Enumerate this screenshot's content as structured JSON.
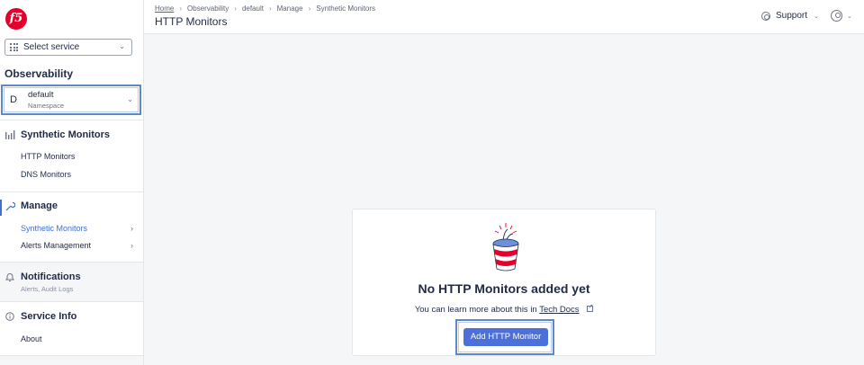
{
  "brand": {
    "logo_text": "f5",
    "logo_color": "#e4002b"
  },
  "service_select": {
    "label": "Select service"
  },
  "sidebar": {
    "section_title": "Observability",
    "namespace": {
      "letter": "D",
      "name": "default",
      "sublabel": "Namespace"
    },
    "groups": [
      {
        "title": "Synthetic Monitors",
        "icon": "bar-chart-icon",
        "items": [
          {
            "label": "HTTP Monitors"
          },
          {
            "label": "DNS Monitors"
          }
        ]
      },
      {
        "title": "Manage",
        "icon": "wrench-icon",
        "items": [
          {
            "label": "Synthetic Monitors",
            "active": true
          },
          {
            "label": "Alerts Management"
          }
        ]
      },
      {
        "title": "Notifications",
        "icon": "bell-icon",
        "hint": "Alerts, Audit Logs"
      },
      {
        "title": "Service Info",
        "icon": "info-icon",
        "items": [
          {
            "label": "About"
          }
        ]
      }
    ]
  },
  "header": {
    "breadcrumb": [
      "Home",
      "Observability",
      "default",
      "Manage",
      "Synthetic Monitors"
    ],
    "title": "HTTP Monitors",
    "support_label": "Support"
  },
  "empty_state": {
    "title": "No HTTP Monitors added yet",
    "desc_prefix": "You can learn more about this in",
    "link_label": "Tech Docs",
    "button_label": "Add HTTP Monitor"
  },
  "colors": {
    "accent": "#4b70d9",
    "focus_outline": "#5d88c9",
    "text": "#1f2a44",
    "background": "#f5f6f8"
  }
}
